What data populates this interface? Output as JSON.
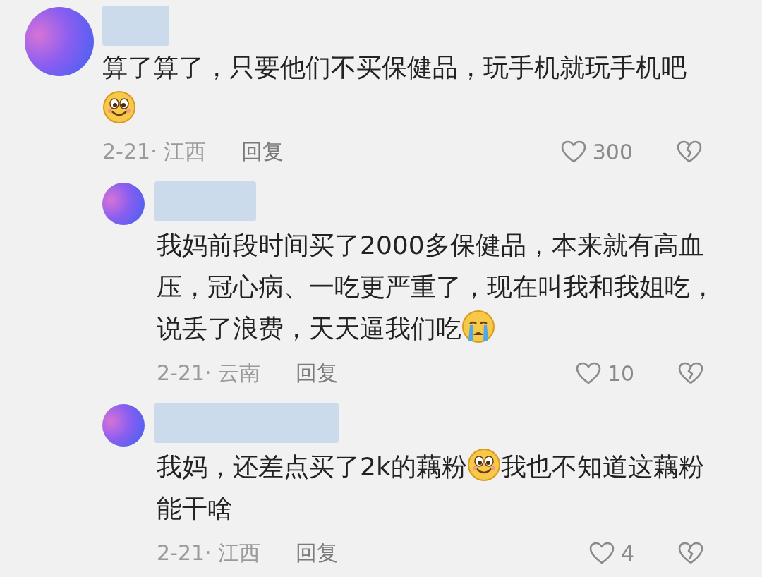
{
  "comments": [
    {
      "reply": false,
      "content": [
        {
          "kind": "text",
          "text": "算了算了，只要他们不买保健品，玩手机就玩手机吧"
        },
        {
          "kind": "smiley"
        }
      ],
      "date_location": "2-21· 江西",
      "reply_label": "回复",
      "likes": "300"
    },
    {
      "reply": true,
      "content": [
        {
          "kind": "text",
          "text": "我妈前段时间买了2000多保健品，本来就有高血压，冠心病、一吃更严重了，现在叫我和我姐吃，说丢了浪费，天天逼我们吃"
        },
        {
          "kind": "crying"
        }
      ],
      "date_location": "2-21· 云南",
      "reply_label": "回复",
      "likes": "10"
    },
    {
      "reply": true,
      "content": [
        {
          "kind": "text",
          "text": "我妈，还差点买了2k的藕粉"
        },
        {
          "kind": "smiley"
        },
        {
          "kind": "text",
          "text": "我也不知道这藕粉能干啥"
        }
      ],
      "date_location": "2-21· 江西",
      "reply_label": "回复",
      "likes": "4"
    }
  ]
}
